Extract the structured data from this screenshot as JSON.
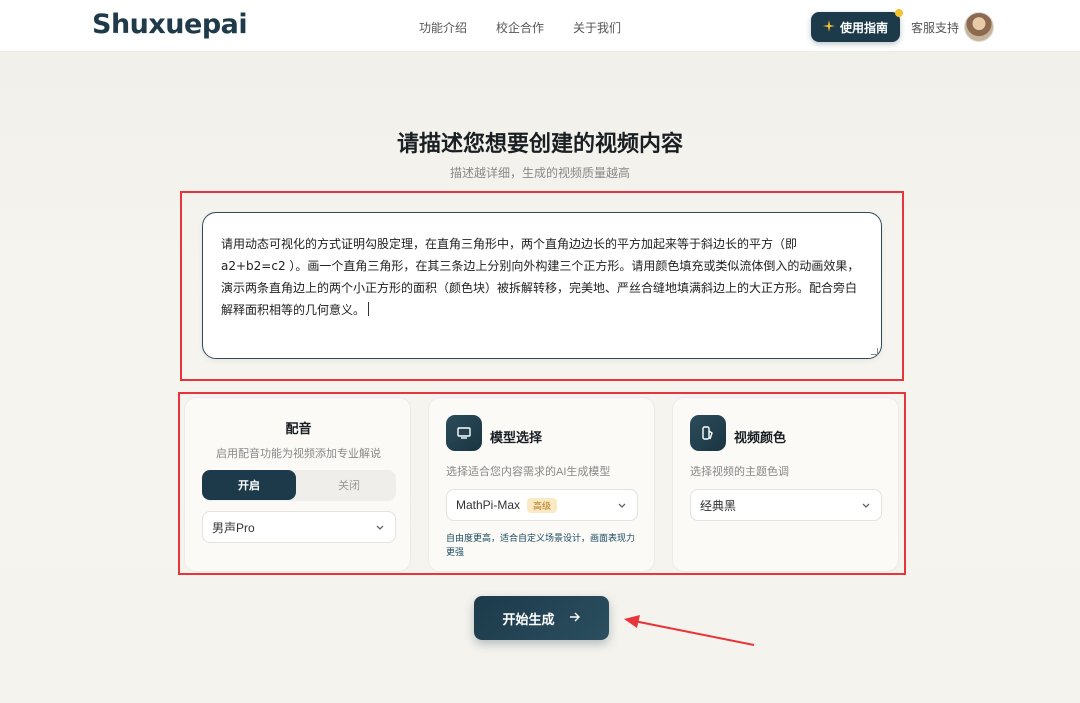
{
  "header": {
    "logo": "Shuxuepai",
    "nav": [
      "功能介绍",
      "校企合作",
      "关于我们"
    ],
    "guide_button": "使用指南",
    "support": "客服支持"
  },
  "hero": {
    "title": "请描述您想要创建的视频内容",
    "subtitle": "描述越详细，生成的视频质量越高"
  },
  "prompt": {
    "value": "请用动态可视化的方式证明勾股定理，在直角三角形中，两个直角边边长的平方加起来等于斜边长的平方（即 a2+b2=c2 ）。画一个直角三角形，在其三条边上分别向外构建三个正方形。请用颜色填充或类似流体倒入的动画效果，演示两条直角边上的两个小正方形的面积（颜色块）被拆解转移，完美地、严丝合缝地填满斜边上的大正方形。配合旁白解释面积相等的几何意义。"
  },
  "voice": {
    "title": "配音",
    "desc": "启用配音功能为视频添加专业解说",
    "on_label": "开启",
    "off_label": "关闭",
    "selected": "男声Pro"
  },
  "model": {
    "title": "模型选择",
    "desc": "选择适合您内容需求的AI生成模型",
    "selected": "MathPi-Max",
    "badge": "高级",
    "note": "自由度更高，适合自定义场景设计，画面表现力更强"
  },
  "color": {
    "title": "视频颜色",
    "desc": "选择视频的主题色调",
    "selected": "经典黑"
  },
  "start_button": "开始生成",
  "colors": {
    "primary": "#1c3a4a",
    "annotation": "#e8343b",
    "badge_bg": "#fbe9c3"
  }
}
